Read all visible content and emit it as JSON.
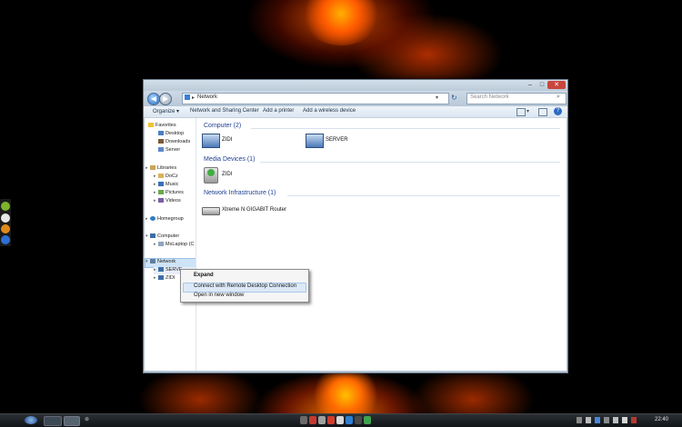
{
  "window": {
    "breadcrumb": "Network",
    "search_placeholder": "Search Network"
  },
  "toolbar": {
    "items": [
      "Organize ▾",
      "Network and Sharing Center",
      "Add a printer",
      "Add a wireless device"
    ]
  },
  "nav": {
    "favorites": "Favorites",
    "favorites_items": [
      "Desktop",
      "Downloads",
      "Server"
    ],
    "libraries": "Libraries",
    "libraries_items": [
      "DoCz",
      "Music",
      "Pictures",
      "Videos"
    ],
    "homegroup": "Homegroup",
    "computer": "Computer",
    "computer_items": [
      "MsLaptop (C"
    ],
    "network": "Network",
    "network_items": [
      "SERVE",
      "ZIDI"
    ]
  },
  "groups": [
    {
      "title": "Computer (2)",
      "items": [
        "ZIDI",
        "SERVER"
      ]
    },
    {
      "title": "Media Devices (1)",
      "items": [
        "ZIDI"
      ]
    },
    {
      "title": "Network Infrastructure (1)",
      "items": [
        "Xtreme N GIGABIT Router"
      ]
    }
  ],
  "context_menu": {
    "items": [
      "Expand",
      "Connect with Remote Desktop Connection",
      "Open in new window"
    ]
  },
  "taskbar": {
    "clock": "22:40"
  },
  "colors": {
    "accent": "#1e3f93",
    "highlight": "#dce9f8"
  }
}
